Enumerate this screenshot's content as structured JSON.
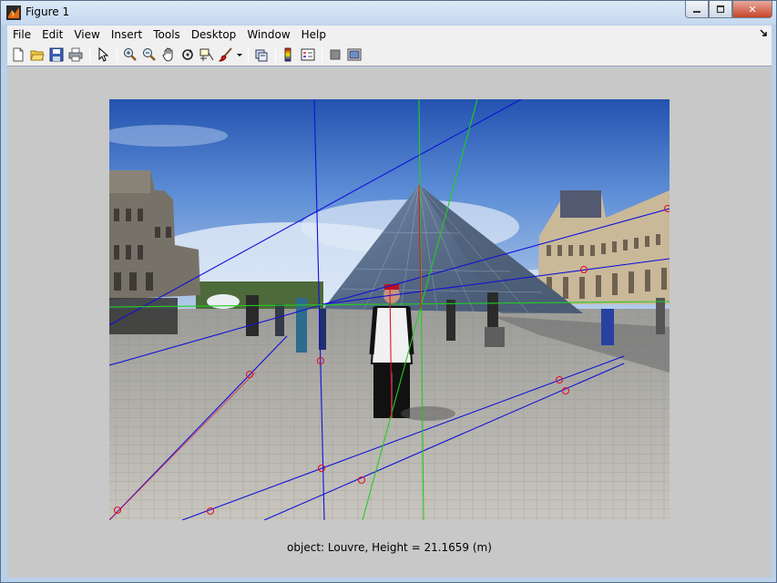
{
  "window": {
    "title": "Figure 1",
    "min_icon": "minimize-icon",
    "max_icon": "maximize-icon",
    "close_label": "✕"
  },
  "menu": {
    "items": [
      "File",
      "Edit",
      "View",
      "Insert",
      "Tools",
      "Desktop",
      "Window",
      "Help"
    ]
  },
  "toolbar": {
    "icons": [
      "new-figure-icon",
      "open-file-icon",
      "save-icon",
      "print-icon",
      "edit-plot-icon",
      "zoom-in-icon",
      "zoom-out-icon",
      "pan-icon",
      "rotate-3d-icon",
      "data-cursor-icon",
      "brush-icon",
      "link-plot-icon",
      "colorbar-icon",
      "legend-icon",
      "hide-plot-tools-icon",
      "show-plot-tools-icon"
    ]
  },
  "figure": {
    "caption": "object: Louvre, Height = 21.1659 (m)",
    "line_colors": {
      "blue": "#1010d8",
      "green": "#22cc22",
      "red": "#e0102a"
    }
  }
}
